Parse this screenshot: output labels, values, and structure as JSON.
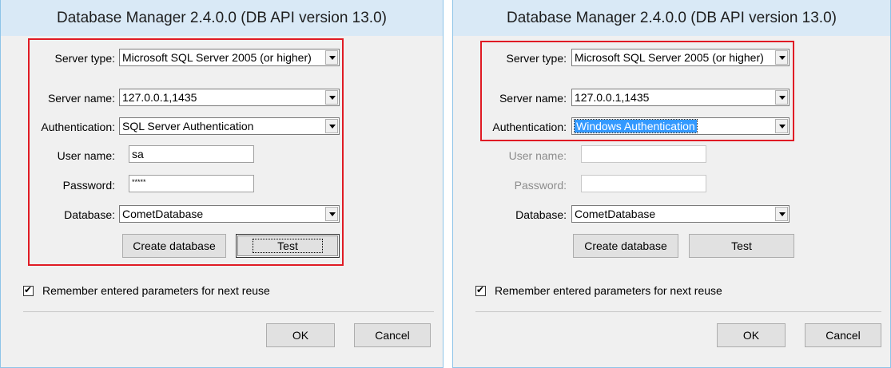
{
  "dialogs": [
    {
      "title": "Database Manager  2.4.0.0  (DB API version 13.0)",
      "server_type_label": "Server type:",
      "server_type_value": "Microsoft SQL Server 2005 (or higher)",
      "server_name_label": "Server name:",
      "server_name_value": "127.0.0.1,1435",
      "auth_label": "Authentication:",
      "auth_value": "SQL Server Authentication",
      "user_label": "User name:",
      "user_value": "sa",
      "password_label": "Password:",
      "password_value": "*****",
      "database_label": "Database:",
      "database_value": "CometDatabase",
      "create_db_label": "Create database",
      "test_label": "Test",
      "remember_label": "Remember entered parameters for next reuse",
      "remember_checked": true,
      "ok_label": "OK",
      "cancel_label": "Cancel"
    },
    {
      "title": "Database Manager  2.4.0.0  (DB API version 13.0)",
      "server_type_label": "Server type:",
      "server_type_value": "Microsoft SQL Server 2005 (or higher)",
      "server_name_label": "Server name:",
      "server_name_value": "127.0.0.1,1435",
      "auth_label": "Authentication:",
      "auth_value": "Windows Authentication",
      "user_label": "User name:",
      "user_value": "",
      "password_label": "Password:",
      "password_value": "",
      "database_label": "Database:",
      "database_value": "CometDatabase",
      "create_db_label": "Create database",
      "test_label": "Test",
      "remember_label": "Remember entered parameters for next reuse",
      "remember_checked": true,
      "ok_label": "OK",
      "cancel_label": "Cancel"
    }
  ],
  "colors": {
    "highlight_frame": "#e01b24",
    "selection": "#3399ff",
    "titlebar": "#d9e9f6"
  }
}
